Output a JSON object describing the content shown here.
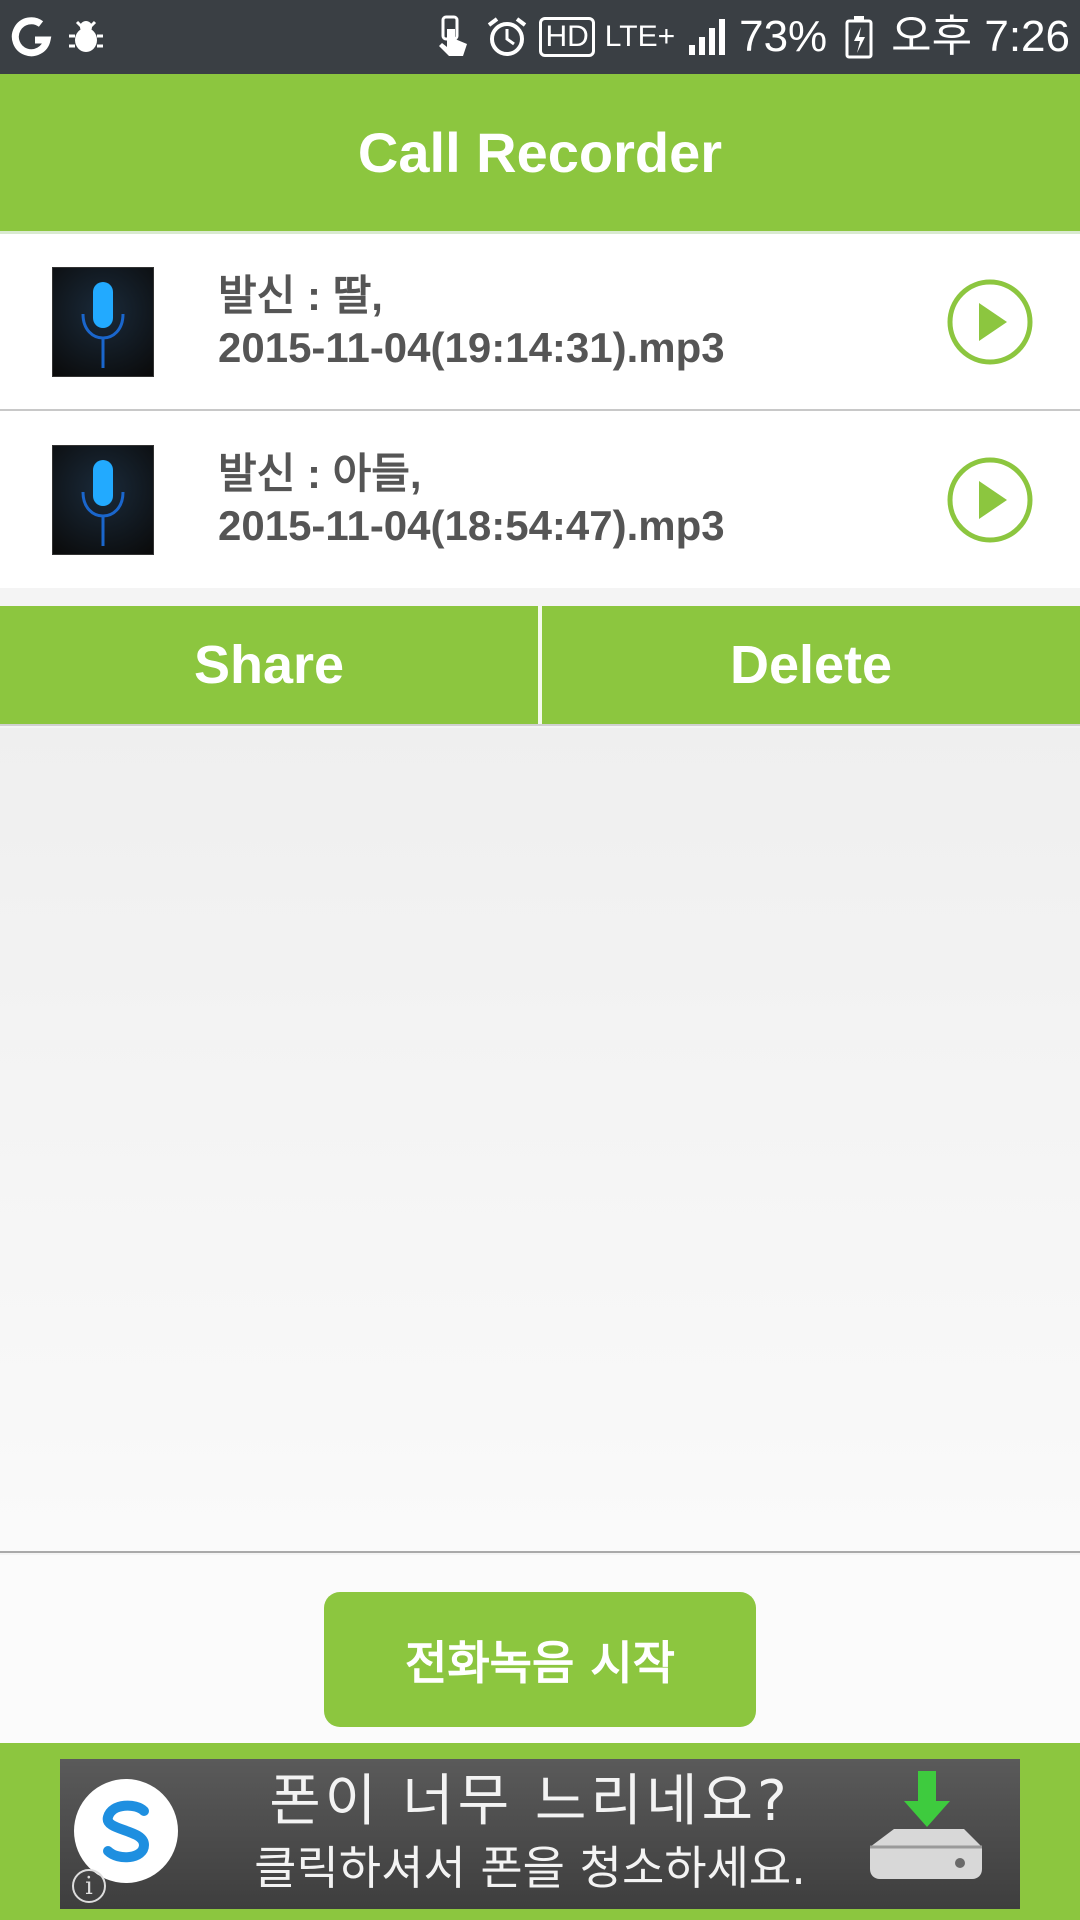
{
  "status_bar": {
    "battery_percent": "73%",
    "time": "오후 7:26",
    "network": "LTE+",
    "hd_label": "HD",
    "icons": [
      "carrier-logo-icon",
      "bug-icon",
      "touch-icon",
      "alarm-icon",
      "hd-voice-icon",
      "lte-icon",
      "signal-icon",
      "battery-icon"
    ]
  },
  "app_bar": {
    "title": "Call Recorder"
  },
  "recordings": [
    {
      "line1": "발신 : 딸,",
      "line2": "2015-11-04(19:14:31).mp3"
    },
    {
      "line1": "발신 : 아들,",
      "line2": "2015-11-04(18:54:47).mp3"
    }
  ],
  "actions": {
    "share_label": "Share",
    "delete_label": "Delete"
  },
  "start_button": {
    "label": "전화녹음 시작"
  },
  "ad": {
    "line1": "폰이 너무 느리네요?",
    "line2": "클릭하셔서 폰을 청소하세요.",
    "info_label": "i"
  },
  "colors": {
    "accent": "#8cc63f",
    "status_bar": "#3a3f44",
    "text": "#555555"
  }
}
